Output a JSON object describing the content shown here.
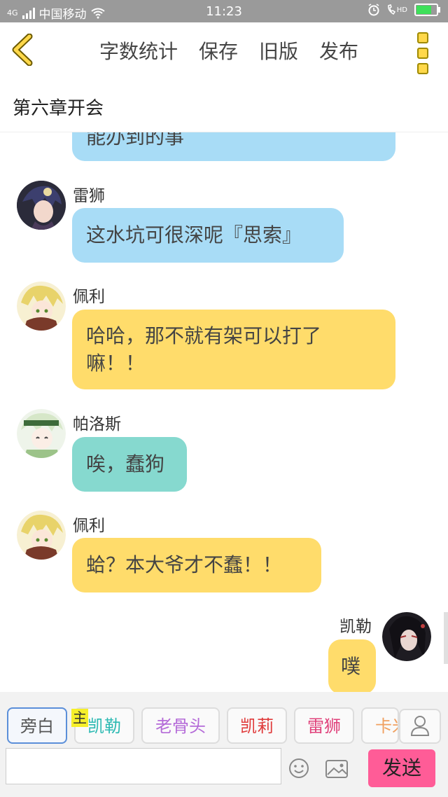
{
  "status_bar": {
    "network": "4G",
    "carrier": "中国移动",
    "time": "11:23",
    "hd": "HD"
  },
  "toolbar": {
    "actions": [
      "字数统计",
      "保存",
      "旧版",
      "发布"
    ]
  },
  "chapter": {
    "title": "第六章开会"
  },
  "messages": [
    {
      "sender": "",
      "text": "能办到的事",
      "color": "#a8dcf6",
      "side": "left",
      "partial": true
    },
    {
      "sender": "雷狮",
      "text": "这水坑可很深呢『思索』",
      "color": "#a8dcf6",
      "side": "left"
    },
    {
      "sender": "佩利",
      "text_lines": [
        "哈哈，那不就有架可以打了",
        "嘛！！"
      ],
      "color": "#ffdc6b",
      "side": "left"
    },
    {
      "sender": "帕洛斯",
      "text": "唉，蠢狗",
      "color": "#86d9cf",
      "side": "left"
    },
    {
      "sender": "佩利",
      "text": "蛤？本大爷才不蠢！！",
      "color": "#ffdc6b",
      "side": "left"
    },
    {
      "sender": "凯勒",
      "text": "噗",
      "color": "#ffdc6b",
      "side": "right"
    }
  ],
  "roles": [
    {
      "label": "旁白",
      "color": "#555555",
      "selected": true
    },
    {
      "label": "凯勒",
      "color": "#2bb9b2",
      "main": true
    },
    {
      "label": "老骨头",
      "color": "#b46ad8"
    },
    {
      "label": "凯莉",
      "color": "#e03b3b"
    },
    {
      "label": "雷狮",
      "color": "#e0407a"
    },
    {
      "label": "卡米",
      "color": "#f0a060"
    }
  ],
  "main_tag": "主",
  "input": {
    "value": "",
    "placeholder": ""
  },
  "send_label": "发送",
  "colors": {
    "accent_yellow": "#ffd84a",
    "send": "#ff5c97"
  }
}
